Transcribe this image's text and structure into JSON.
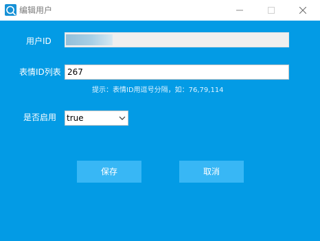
{
  "window": {
    "title": "编辑用户"
  },
  "form": {
    "user_id_label": "用户ID",
    "user_id_value": "",
    "emoji_list_label": "表情ID列表",
    "emoji_list_value": "267",
    "hint": "提示：表情ID用逗号分隔，如：76,79,114",
    "enabled_label": "是否启用",
    "enabled_value": "true"
  },
  "buttons": {
    "save": "保存",
    "cancel": "取消"
  },
  "colors": {
    "background": "#039be5",
    "button": "#38b7f5",
    "titlebar": "#ffffff"
  }
}
